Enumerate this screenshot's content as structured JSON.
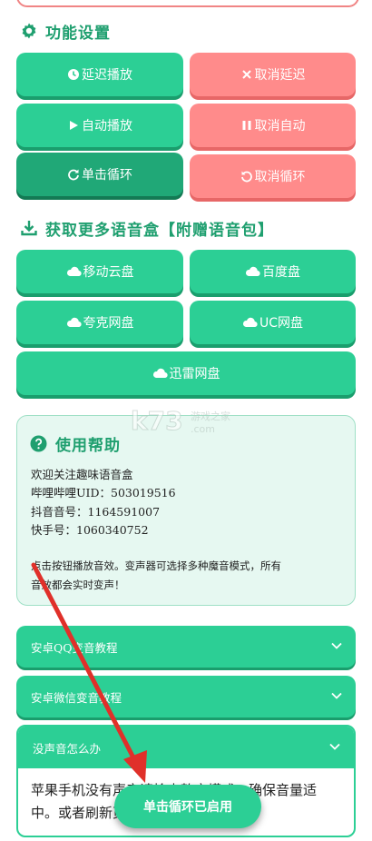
{
  "section_function": {
    "title": "功能设置",
    "icon": "gear-icon"
  },
  "buttons": {
    "delay_play": {
      "label": "延迟播放",
      "icon": "clock-icon"
    },
    "cancel_delay": {
      "label": "取消延迟",
      "icon": "close-icon"
    },
    "auto_play": {
      "label": "自动播放",
      "icon": "play-icon"
    },
    "cancel_auto": {
      "label": "取消自动",
      "icon": "pause-icon"
    },
    "single_loop": {
      "label": "单击循环",
      "icon": "redo-icon"
    },
    "cancel_loop": {
      "label": "取消循环",
      "icon": "undo-icon"
    }
  },
  "section_more": {
    "title": "获取更多语音盒【附赠语音包】",
    "icon": "download-icon"
  },
  "cloud": {
    "mobile": "移动云盘",
    "baidu": "百度盘",
    "quark": "夸克网盘",
    "uc": "UC网盘",
    "xunlei": "迅雷网盘"
  },
  "help": {
    "title": "使用帮助",
    "welcome": "欢迎关注趣味语音盒",
    "bilibili": "哔哩哔哩UID：503019516",
    "douyin": "抖音音号：1164591007",
    "kuaishou": "快手号：1060340752",
    "desc1": "点击按钮播放音效。变声器可选择多种魔音模式，所有",
    "desc2": "音效都会实时变声！"
  },
  "accordion": {
    "qq": "安卓QQ变音教程",
    "wechat": "安卓微信变音教程",
    "nosound": "没声音怎么办",
    "nosound_body_1": "苹果手机没有声音请检查静音模式，确保音量适",
    "nosound_body_2": "中。或者刷新页面，可能加载不完整"
  },
  "toast": "单击循环已启用",
  "watermark": {
    "brand": "k73",
    "sub": "游戏之家",
    "domain": ".com"
  },
  "colors": {
    "green": "#2ccf95",
    "red": "#ff8b8b",
    "title_green": "#1f9f6f",
    "arrow": "#e0302a"
  }
}
